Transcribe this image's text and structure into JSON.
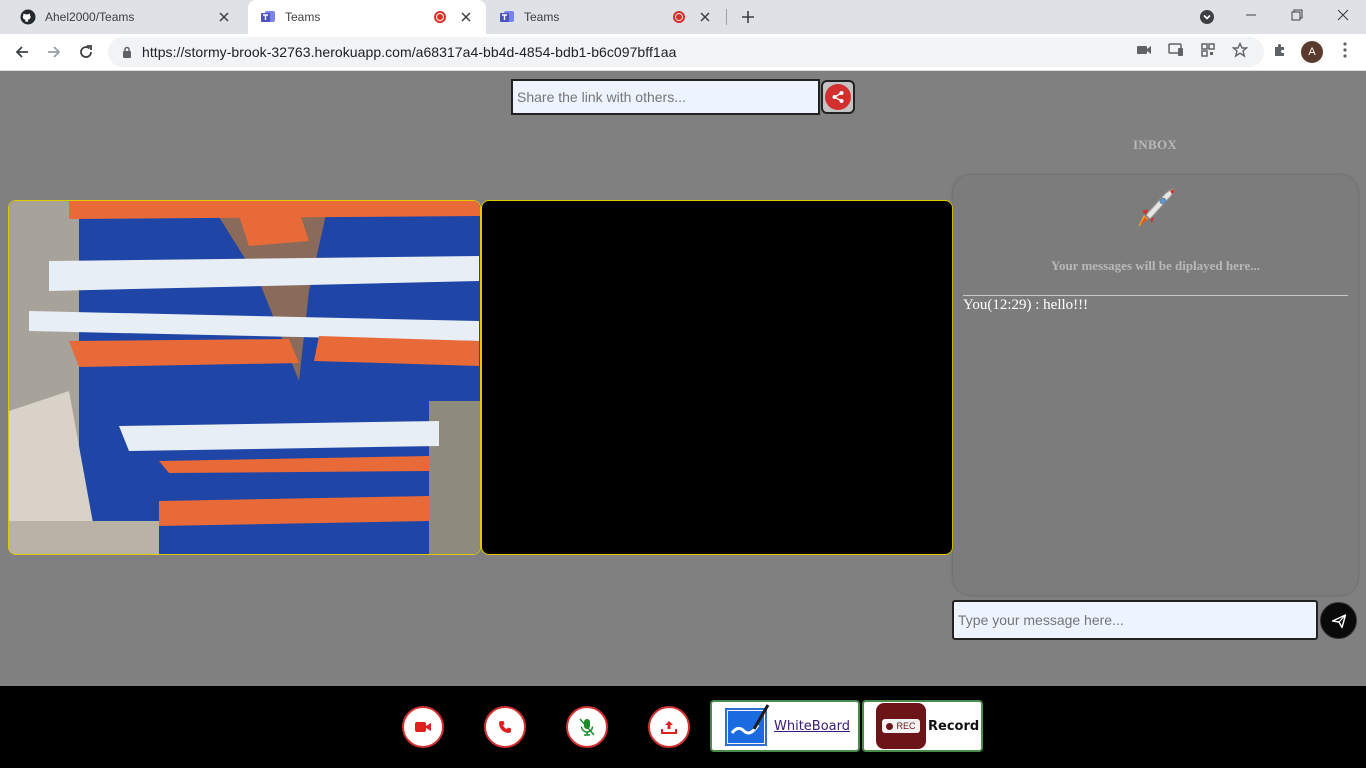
{
  "browser": {
    "tabs": [
      {
        "title": "Ahel2000/Teams",
        "icon": "github-icon",
        "active": false,
        "recording": false
      },
      {
        "title": "Teams",
        "icon": "teams-icon",
        "active": true,
        "recording": true
      },
      {
        "title": "Teams",
        "icon": "teams-icon",
        "active": false,
        "recording": true
      }
    ],
    "url": "https://stormy-brook-32763.herokuapp.com/a68317a4-bb4d-4854-bdb1-b6c097bff1aa",
    "profile_initial": "A"
  },
  "share": {
    "placeholder": "Share the link with others...",
    "button_icon": "share-icon"
  },
  "videos": {
    "local": {
      "label": "local-video"
    },
    "remote": {
      "label": "remote-video"
    }
  },
  "inbox": {
    "title": "INBOX",
    "empty_text": "Your messages will be diplayed here...",
    "messages": [
      {
        "text": "You(12:29) : hello!!!"
      }
    ],
    "input_placeholder": "Type your message here...",
    "send_icon": "send-icon"
  },
  "controls": {
    "buttons": [
      "video-camera-icon",
      "phone-icon",
      "microphone-icon",
      "screen-share-icon"
    ],
    "whiteboard_label": "WhiteBoard",
    "record_label": "Record",
    "record_badge": "REC"
  },
  "colors": {
    "control_accent": "#d32f2f",
    "video_border": "#e3c800",
    "page_background": "#808080"
  }
}
